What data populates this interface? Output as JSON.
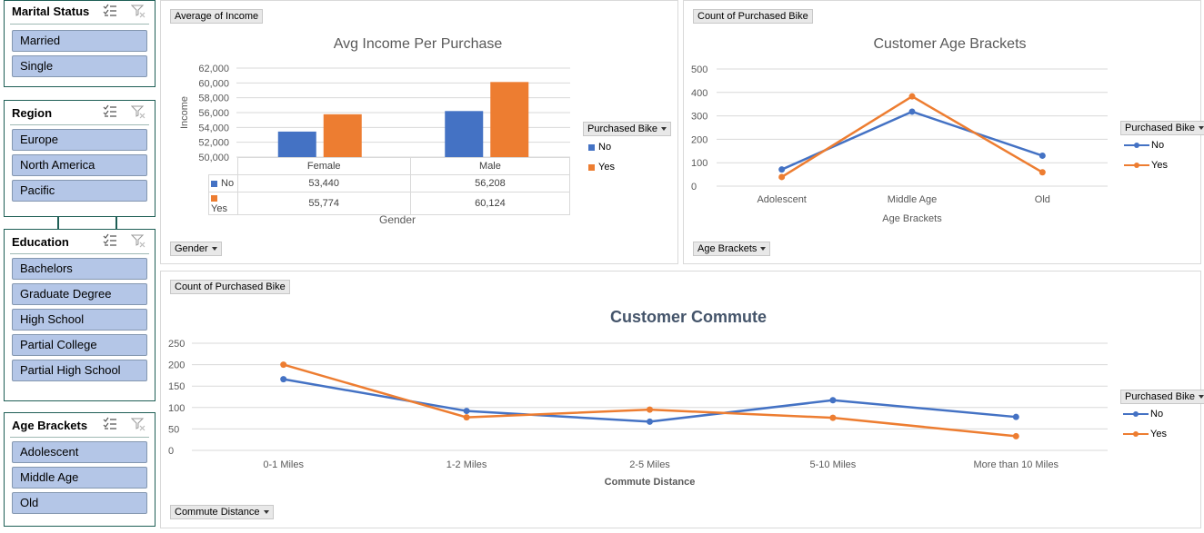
{
  "slicers": [
    {
      "title": "Marital Status",
      "items": [
        "Married",
        "Single"
      ]
    },
    {
      "title": "Region",
      "items": [
        "Europe",
        "North America",
        "Pacific"
      ]
    },
    {
      "title": "Education",
      "items": [
        "Bachelors",
        "Graduate Degree",
        "High School",
        "Partial College",
        "Partial High School"
      ]
    },
    {
      "title": "Age Brackets",
      "items": [
        "Adolescent",
        "Middle Age",
        "Old"
      ]
    }
  ],
  "colors": {
    "no": "#4472c4",
    "yes": "#ed7d31",
    "slicer_item": "#b4c6e7",
    "slicer_border": "#1f5f56"
  },
  "legend": {
    "title": "Purchased Bike",
    "no": "No",
    "yes": "Yes"
  },
  "chart_data": [
    {
      "type": "bar",
      "field_button": "Average of Income",
      "axis_button": "Gender",
      "title": "Avg Income Per Purchase",
      "xlabel": "Gender",
      "ylabel": "Income",
      "categories": [
        "Female",
        "Male"
      ],
      "series": [
        {
          "name": "No",
          "values": [
            53440,
            56208
          ],
          "labels": [
            "53,440",
            "56,208"
          ]
        },
        {
          "name": "Yes",
          "values": [
            55774,
            60124
          ],
          "labels": [
            "55,774",
            "60,124"
          ]
        }
      ],
      "ylim": [
        50000,
        62000
      ],
      "yticks": [
        "50,000",
        "52,000",
        "54,000",
        "56,000",
        "58,000",
        "60,000",
        "62,000"
      ],
      "data_table": true,
      "legend_position": "right"
    },
    {
      "type": "line",
      "field_button": "Count of Purchased Bike",
      "axis_button": "Age Brackets",
      "title": "Customer Age Brackets",
      "xlabel": "Age Brackets",
      "ylabel": "",
      "categories": [
        "Adolescent",
        "Middle Age",
        "Old"
      ],
      "series": [
        {
          "name": "No",
          "values": [
            71,
            318,
            130
          ]
        },
        {
          "name": "Yes",
          "values": [
            39,
            383,
            59
          ]
        }
      ],
      "ylim": [
        0,
        500
      ],
      "yticks": [
        "0",
        "100",
        "200",
        "300",
        "400",
        "500"
      ],
      "legend_position": "right"
    },
    {
      "type": "line",
      "field_button": "Count of Purchased Bike",
      "axis_button": "Commute Distance",
      "title": "Customer Commute",
      "xlabel": "Commute Distance",
      "ylabel": "",
      "categories": [
        "0-1 Miles",
        "1-2 Miles",
        "2-5 Miles",
        "5-10 Miles",
        "More than 10 Miles"
      ],
      "series": [
        {
          "name": "No",
          "values": [
            166,
            92,
            67,
            117,
            78
          ]
        },
        {
          "name": "Yes",
          "values": [
            200,
            77,
            95,
            76,
            33
          ]
        }
      ],
      "ylim": [
        0,
        250
      ],
      "yticks": [
        "0",
        "50",
        "100",
        "150",
        "200",
        "250"
      ],
      "legend_position": "right"
    }
  ]
}
